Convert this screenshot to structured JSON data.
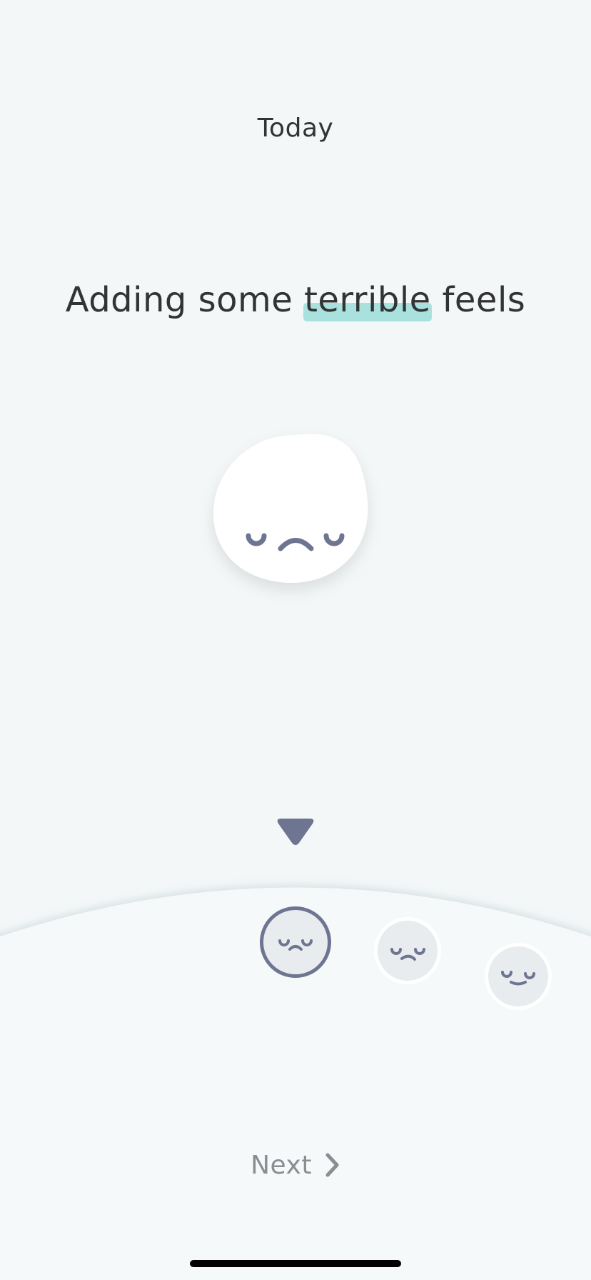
{
  "header": {
    "title": "Today"
  },
  "prompt": {
    "prefix": "Adding some ",
    "highlight": "terrible",
    "suffix": " feels"
  },
  "selected_mood": {
    "face_icon": "sad-face-icon"
  },
  "mood_picker": {
    "items": [
      {
        "icon": "sad-face-icon",
        "selected": true
      },
      {
        "icon": "unhappy-face-icon",
        "selected": false
      },
      {
        "icon": "meh-face-icon",
        "selected": false
      }
    ],
    "pointer_icon": "triangle-down-icon"
  },
  "footer": {
    "next_label": "Next",
    "next_icon": "chevron-right-icon"
  },
  "colors": {
    "background": "#f3f7f8",
    "face": "#6d7591",
    "highlight": "#a9e1df",
    "next_text": "#8a8d92"
  }
}
